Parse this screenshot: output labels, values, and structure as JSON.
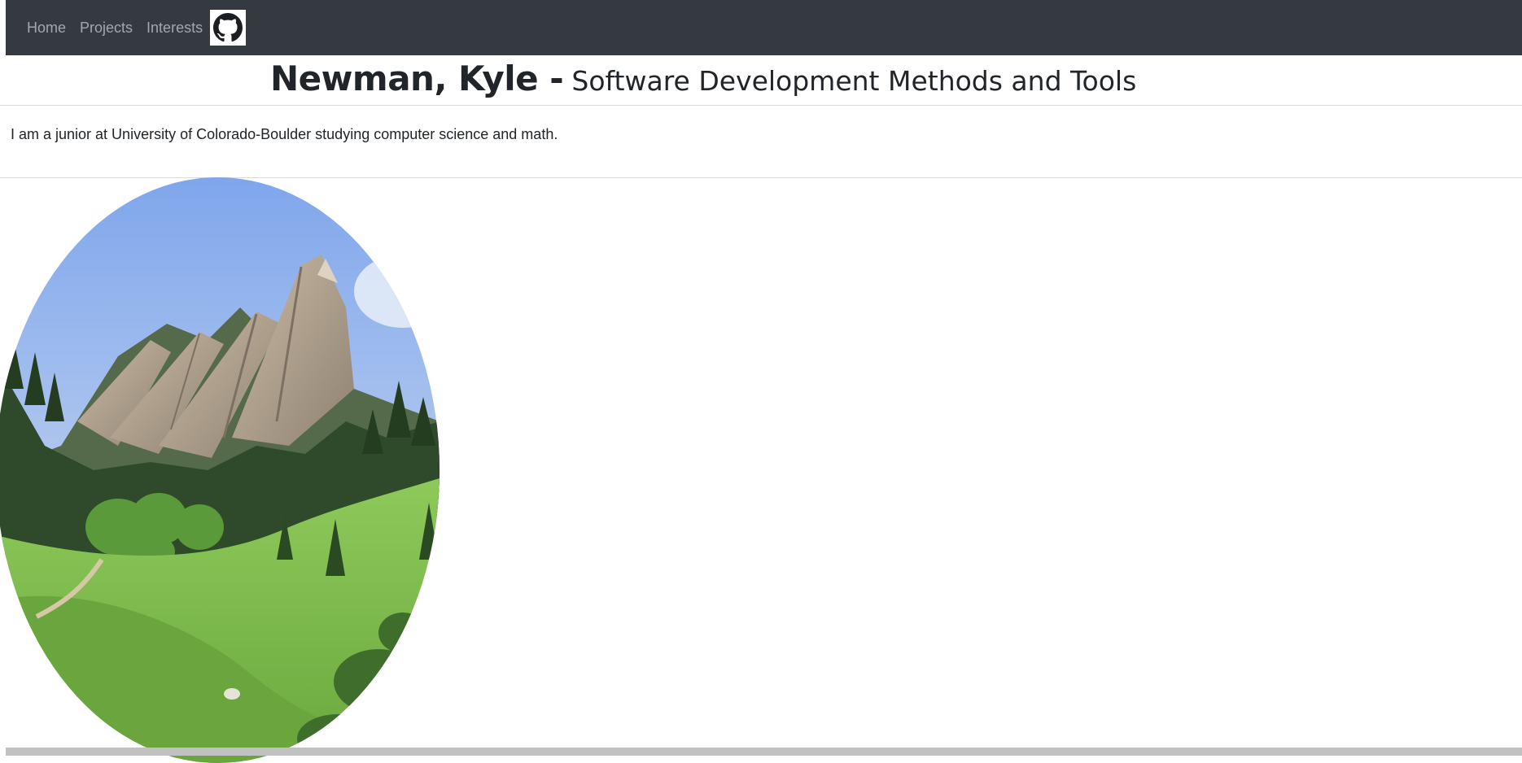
{
  "nav": {
    "items": [
      {
        "label": "Home"
      },
      {
        "label": "Projects"
      },
      {
        "label": "Interests"
      }
    ],
    "github_icon": "github-octocat-icon"
  },
  "header": {
    "name": "Newman, Kyle -",
    "subtitle": "Software Development Methods and Tools"
  },
  "intro": {
    "text": "I am a junior at University of Colorado-Boulder studying computer science and math."
  },
  "hero_image": {
    "subject": "flatirons-mountain-photo",
    "colors": {
      "sky": "#8fb0e8",
      "rock": "#b9ab98",
      "forest": "#2f4a2a",
      "meadow": "#7fbf4d"
    }
  },
  "colors": {
    "navbar": "#343a40",
    "nav_link": "#9ea2a6",
    "scrollbar": "#c1c1c1"
  }
}
